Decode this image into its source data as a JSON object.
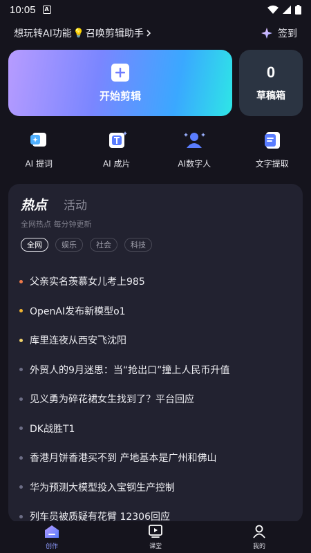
{
  "status": {
    "time": "10:05",
    "notification_icon": "a-icon"
  },
  "header": {
    "promo_text": "想玩转AI功能",
    "promo_action": "召唤剪辑助手",
    "promo_emoji": "💡",
    "signin_label": "签到"
  },
  "create": {
    "label": "开始剪辑"
  },
  "drafts": {
    "count": "0",
    "label": "草稿箱"
  },
  "tools": [
    {
      "label": "AI 提词",
      "icon": "ai-prompt-icon"
    },
    {
      "label": "AI 成片",
      "icon": "ai-film-icon"
    },
    {
      "label": "AI数字人",
      "icon": "ai-avatar-icon"
    },
    {
      "label": "文字提取",
      "icon": "text-extract-icon"
    }
  ],
  "hot": {
    "tabs": [
      "热点",
      "活动"
    ],
    "subtitle": "全网热点 每分钟更新",
    "chips": [
      "全网",
      "娱乐",
      "社会",
      "科技"
    ],
    "items": [
      {
        "text": "父亲实名羡慕女儿考上985",
        "dot": "#f07a4a"
      },
      {
        "text": "OpenAI发布新模型o1",
        "dot": "#f2b531"
      },
      {
        "text": "库里连夜从西安飞沈阳",
        "dot": "#f2d36b"
      },
      {
        "text": "外贸人的9月迷思：当“抢出口”撞上人民币升值",
        "dot": "#6d6e86"
      },
      {
        "text": "见义勇为碎花裙女生找到了？平台回应",
        "dot": "#6d6e86"
      },
      {
        "text": "DK战胜T1",
        "dot": "#6d6e86"
      },
      {
        "text": "香港月饼香港买不到 产地基本是广州和佛山",
        "dot": "#6d6e86"
      },
      {
        "text": "华为预测大模型投入宝钢生产控制",
        "dot": "#6d6e86"
      },
      {
        "text": "列车员被质疑有花臂 12306回应",
        "dot": "#6d6e86"
      }
    ]
  },
  "nav": [
    {
      "label": "创作",
      "icon": "create-icon",
      "active": true
    },
    {
      "label": "课堂",
      "icon": "classroom-icon",
      "active": false
    },
    {
      "label": "我的",
      "icon": "profile-icon",
      "active": false
    }
  ],
  "colors": {
    "accent": "#7a86ff",
    "bg": "#15141d",
    "panel": "#222230"
  }
}
